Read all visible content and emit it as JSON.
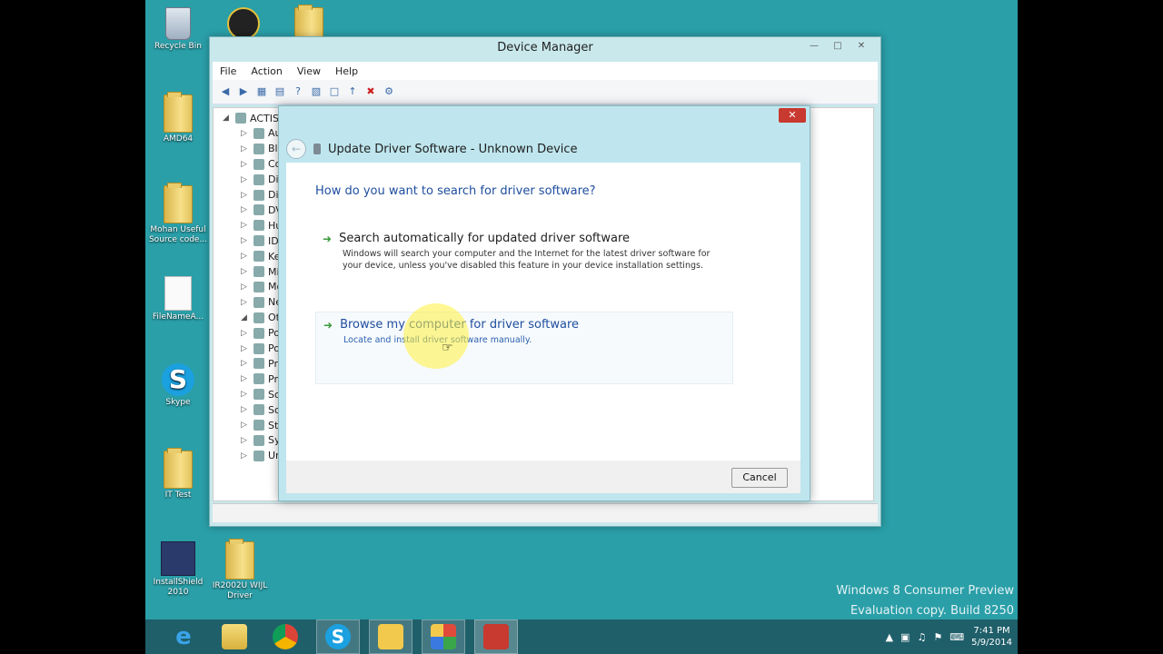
{
  "desktop": {
    "icons": [
      {
        "label": "Recycle Bin",
        "icon": "recycle-bin-icon"
      },
      {
        "label": "AMD64",
        "icon": "folder-icon"
      },
      {
        "label": "Mohan Useful Source code...",
        "icon": "folder-icon"
      },
      {
        "label": "FileNameA...",
        "icon": "document-icon"
      },
      {
        "label": "Skype",
        "icon": "skype-icon"
      },
      {
        "label": "IT Test",
        "icon": "folder-icon"
      },
      {
        "label": "InstallShield 2010",
        "icon": "installshield-icon"
      },
      {
        "label": "IR2002U WIJL Driver",
        "icon": "folder-icon"
      }
    ]
  },
  "device_manager": {
    "title": "Device Manager",
    "menu": [
      "File",
      "Action",
      "View",
      "Help"
    ],
    "tree": [
      "ACTIS...",
      "Au",
      "Bl",
      "Co",
      "Di",
      "Di",
      "DV",
      "Hu",
      "ID",
      "Ke",
      "Mi",
      "Mo",
      "Ne",
      "Ot",
      "Po",
      "Po",
      "Pr",
      "Pr",
      "So",
      "So",
      "St",
      "Sy",
      "Un"
    ]
  },
  "dialog": {
    "title": "Update Driver Software - Unknown Device",
    "question": "How do you want to search for driver software?",
    "option_auto_title": "Search automatically for updated driver software",
    "option_auto_desc": "Windows will search your computer and the Internet for the latest driver software for your device, unless you've disabled this feature in your device installation settings.",
    "option_browse_title": "Browse my computer for driver software",
    "option_browse_desc": "Locate and install driver software manually.",
    "cancel_label": "Cancel"
  },
  "watermark": {
    "line1": "Windows 8 Consumer Preview",
    "line2": "Evaluation copy. Build 8250"
  },
  "taskbar": {
    "time": "7:41 PM",
    "date": "5/9/2014"
  },
  "colors": {
    "desktop": "#2a9fa8",
    "taskbar": "#1f5f6a",
    "link": "#1f4ea0"
  }
}
